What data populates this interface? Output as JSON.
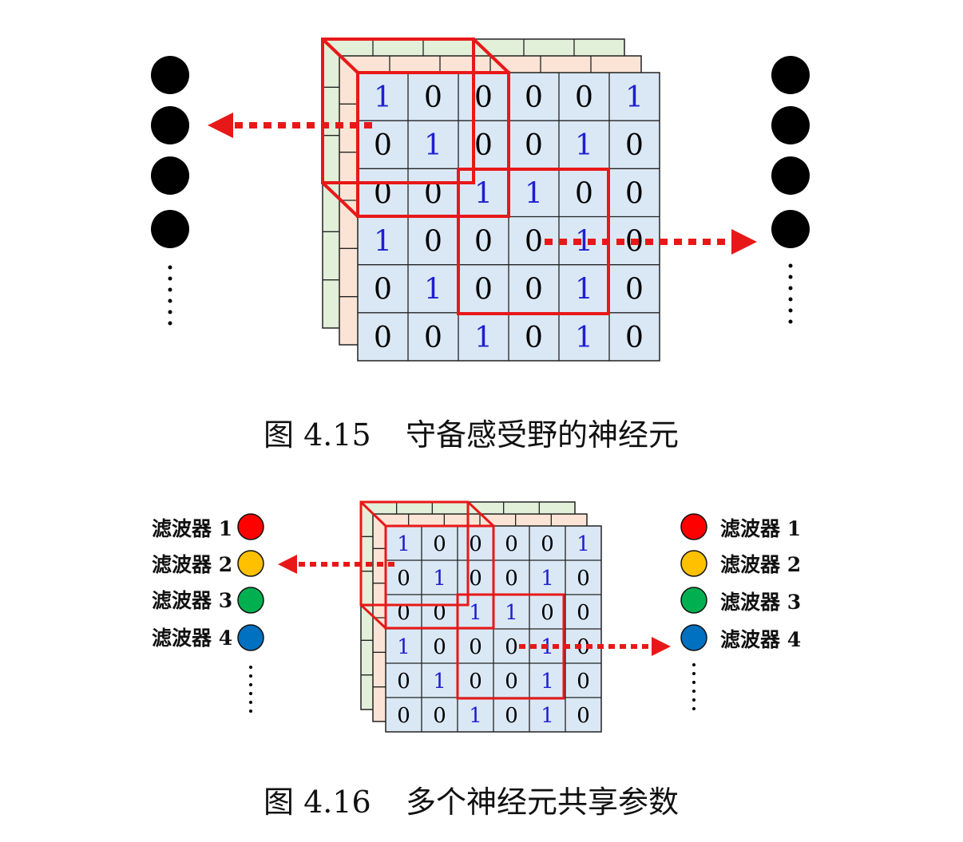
{
  "figure1": {
    "caption_number": "图 4.15",
    "caption_text": "守备感受野的神经元",
    "grid": [
      [
        "1",
        "0",
        "0",
        "0",
        "0",
        "1"
      ],
      [
        "0",
        "1",
        "0",
        "0",
        "1",
        "0"
      ],
      [
        "0",
        "0",
        "1",
        "1",
        "0",
        "0"
      ],
      [
        "1",
        "0",
        "0",
        "0",
        "1",
        "0"
      ],
      [
        "0",
        "1",
        "0",
        "0",
        "1",
        "0"
      ],
      [
        "0",
        "0",
        "1",
        "0",
        "1",
        "0"
      ]
    ],
    "ellipsis": "⋮"
  },
  "figure2": {
    "caption_number": "图 4.16",
    "caption_text": "多个神经元共享参数",
    "grid": [
      [
        "1",
        "0",
        "0",
        "0",
        "0",
        "1"
      ],
      [
        "0",
        "1",
        "0",
        "0",
        "1",
        "0"
      ],
      [
        "0",
        "0",
        "1",
        "1",
        "0",
        "0"
      ],
      [
        "1",
        "0",
        "0",
        "0",
        "1",
        "0"
      ],
      [
        "0",
        "1",
        "0",
        "0",
        "1",
        "0"
      ],
      [
        "0",
        "0",
        "1",
        "0",
        "1",
        "0"
      ]
    ],
    "filters": [
      {
        "label": "滤波器 1",
        "color": "#ff0000"
      },
      {
        "label": "滤波器 2",
        "color": "#ffc000"
      },
      {
        "label": "滤波器 3",
        "color": "#00b050"
      },
      {
        "label": "滤波器 4",
        "color": "#0070c0"
      }
    ],
    "ellipsis": "⋮"
  },
  "colors": {
    "one_digit": "#1f1fcf",
    "zero_digit": "#000000",
    "front_layer": "#dae8f5",
    "middle_layer": "#fbe4d5",
    "back_layer": "#e2efd9",
    "highlight": "#e81818"
  }
}
